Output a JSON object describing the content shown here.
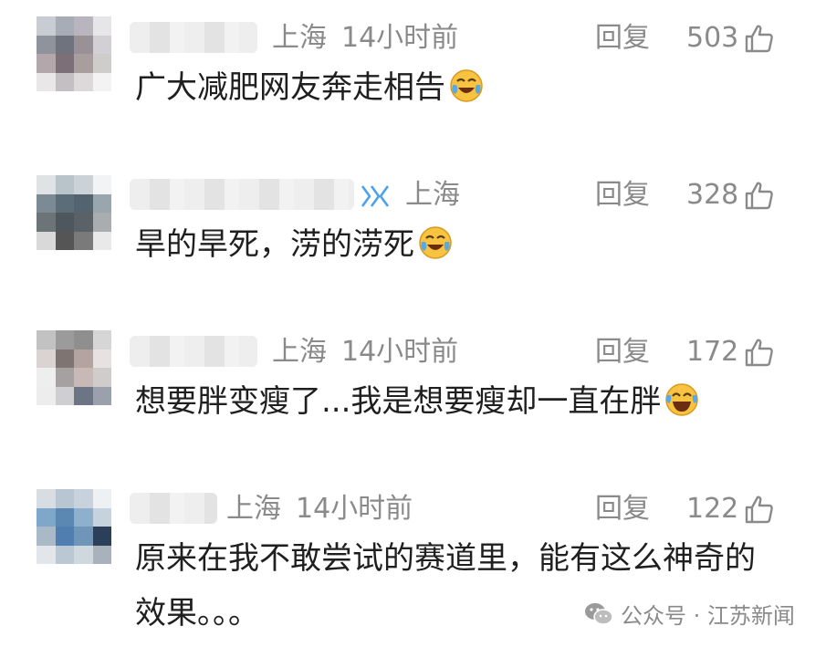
{
  "comments": [
    {
      "location": "上海",
      "time": "14小时前",
      "reply_label": "回复",
      "likes": "503",
      "text": "广大减肥网友奔走相告",
      "emoji": "laughing-crying-emoji",
      "has_vip_badge": false
    },
    {
      "location": "上海",
      "time": "",
      "reply_label": "回复",
      "likes": "328",
      "text": "旱的旱死，涝的涝死",
      "emoji": "laughing-crying-emoji",
      "has_vip_badge": true
    },
    {
      "location": "上海",
      "time": "14小时前",
      "reply_label": "回复",
      "likes": "172",
      "text": "想要胖变瘦了...我是想要瘦却一直在胖",
      "emoji": "tears-of-joy-emoji",
      "has_vip_badge": false
    },
    {
      "location": "上海",
      "time": "14小时前",
      "reply_label": "回复",
      "likes": "122",
      "text": "原来在我不敢尝试的赛道里，能有这么神奇的效果。。。",
      "emoji": "",
      "has_vip_badge": false
    }
  ],
  "watermark": {
    "text": "公众号 · 江苏新闻",
    "icon": "wechat-icon"
  },
  "colors": {
    "meta_gray": "#8a8a8a",
    "text": "#1f1f1f",
    "background": "#ffffff"
  }
}
